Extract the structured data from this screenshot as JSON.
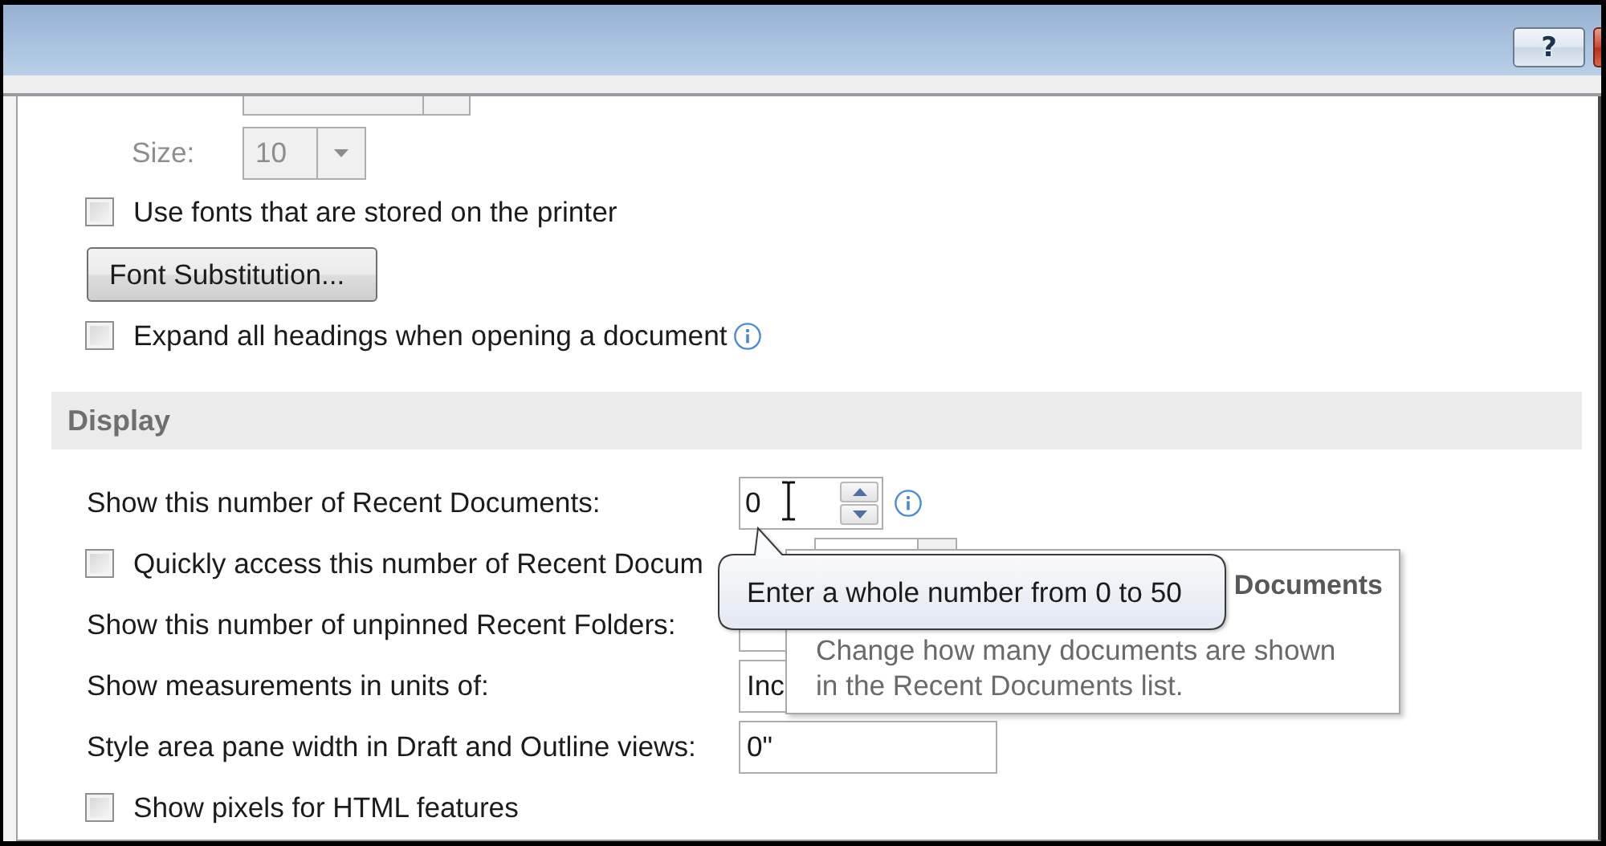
{
  "title_bar": {
    "help_button": "?"
  },
  "font_section": {
    "name_field": {
      "disabled": true
    },
    "size": {
      "label": "Size:",
      "value": "10",
      "disabled": true
    },
    "printer_fonts": {
      "label": "Use fonts that are stored on the printer",
      "checked": false
    },
    "substitution_button": "Font Substitution...",
    "expand_headings": {
      "label": "Expand all headings when opening a document",
      "checked": false
    }
  },
  "display_section": {
    "heading": "Display",
    "rows": [
      {
        "kind": "spinner",
        "label": "Show this number of Recent Documents:",
        "value": "0"
      },
      {
        "kind": "checkcombo",
        "label": "Quickly access this number of Recent Docum",
        "checked": false
      },
      {
        "kind": "partial",
        "label": "Show this number of unpinned Recent Folders:"
      },
      {
        "kind": "partial",
        "label": "Show measurements in units of:",
        "value": "Inc"
      },
      {
        "kind": "field",
        "label": "Style area pane width in Draft and Outline views:",
        "value": "0\""
      },
      {
        "kind": "checkbox",
        "label": "Show pixels for HTML features",
        "checked": false
      }
    ]
  },
  "info_popup": {
    "title": "Documents",
    "description": "Change how many documents are shown in the Recent Documents list."
  },
  "balloon_tip": {
    "text": "Enter a whole number from 0 to 50"
  }
}
